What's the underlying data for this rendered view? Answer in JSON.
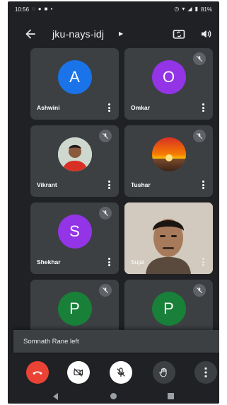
{
  "status_bar": {
    "time": "10:56",
    "left_icons": [
      "notification-icon",
      "notification-icon",
      "notification-icon",
      "notification-icon"
    ],
    "battery": "81%"
  },
  "header": {
    "meeting_code": "jku-nays-idj"
  },
  "participants": [
    {
      "name": "Ashwini",
      "initial": "A",
      "avatar_color": "#1a73e8",
      "muted": false
    },
    {
      "name": "Omkar",
      "initial": "O",
      "avatar_color": "#9334e6",
      "muted": true
    },
    {
      "name": "Vikrant",
      "initial": "",
      "avatar_color": "#ffffff",
      "muted": true
    },
    {
      "name": "Tushar",
      "initial": "",
      "avatar_color": "#f4b400",
      "muted": true
    },
    {
      "name": "Shekhar",
      "initial": "S",
      "avatar_color": "#9334e6",
      "muted": true
    },
    {
      "name": "Sujal",
      "initial": "",
      "avatar_color": "#d9d2c6",
      "muted": false
    },
    {
      "name": "",
      "initial": "P",
      "avatar_color": "#188038",
      "muted": true
    },
    {
      "name": "",
      "initial": "P",
      "avatar_color": "#188038",
      "muted": true
    }
  ],
  "toast": {
    "message": "Somnath Rane left"
  },
  "colors": {
    "background": "#202124",
    "tile": "#3c4043",
    "end_call": "#ea4335",
    "control_light": "#ffffff",
    "control_dark": "#3c4043"
  }
}
